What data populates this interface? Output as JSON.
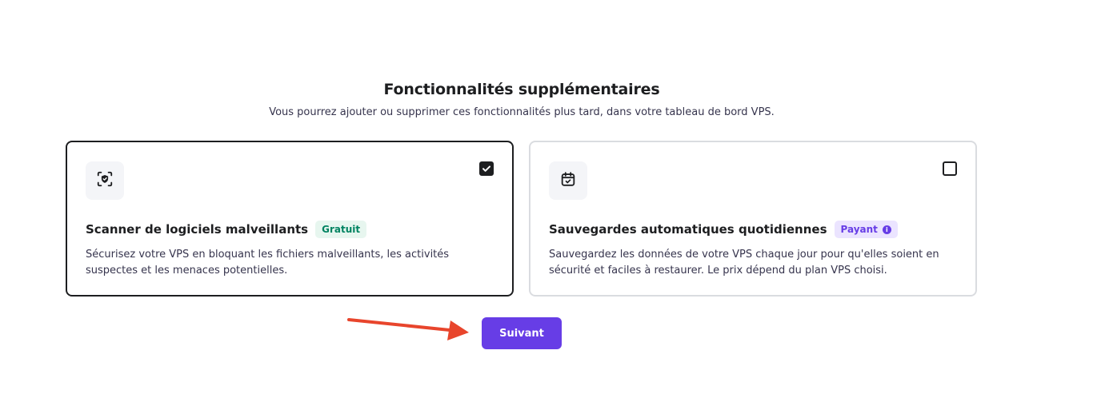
{
  "section": {
    "title": "Fonctionnalités supplémentaires",
    "subtitle": "Vous pourrez ajouter ou supprimer ces fonctionnalités plus tard, dans votre tableau de bord VPS."
  },
  "cards": [
    {
      "title": "Scanner de logiciels malveillants",
      "badge": "Gratuit",
      "description": "Sécurisez votre VPS en bloquant les fichiers malveillants, les activités suspectes et les menaces potentielles.",
      "checked": true,
      "icon": "shield-scan-icon"
    },
    {
      "title": "Sauvegardes automatiques quotidiennes",
      "badge": "Payant",
      "description": "Sauvegardez les données de votre VPS chaque jour pour qu'elles soient en sécurité et faciles à restaurer. Le prix dépend du plan VPS choisi.",
      "checked": false,
      "icon": "calendar-check-icon"
    }
  ],
  "next_button": {
    "label": "Suivant"
  },
  "colors": {
    "accent": "#673de6",
    "free_badge_bg": "#e7f6ef",
    "free_badge_text": "#008361",
    "paid_badge_bg": "#ebe4ff",
    "annotation_arrow": "#e8452c"
  }
}
